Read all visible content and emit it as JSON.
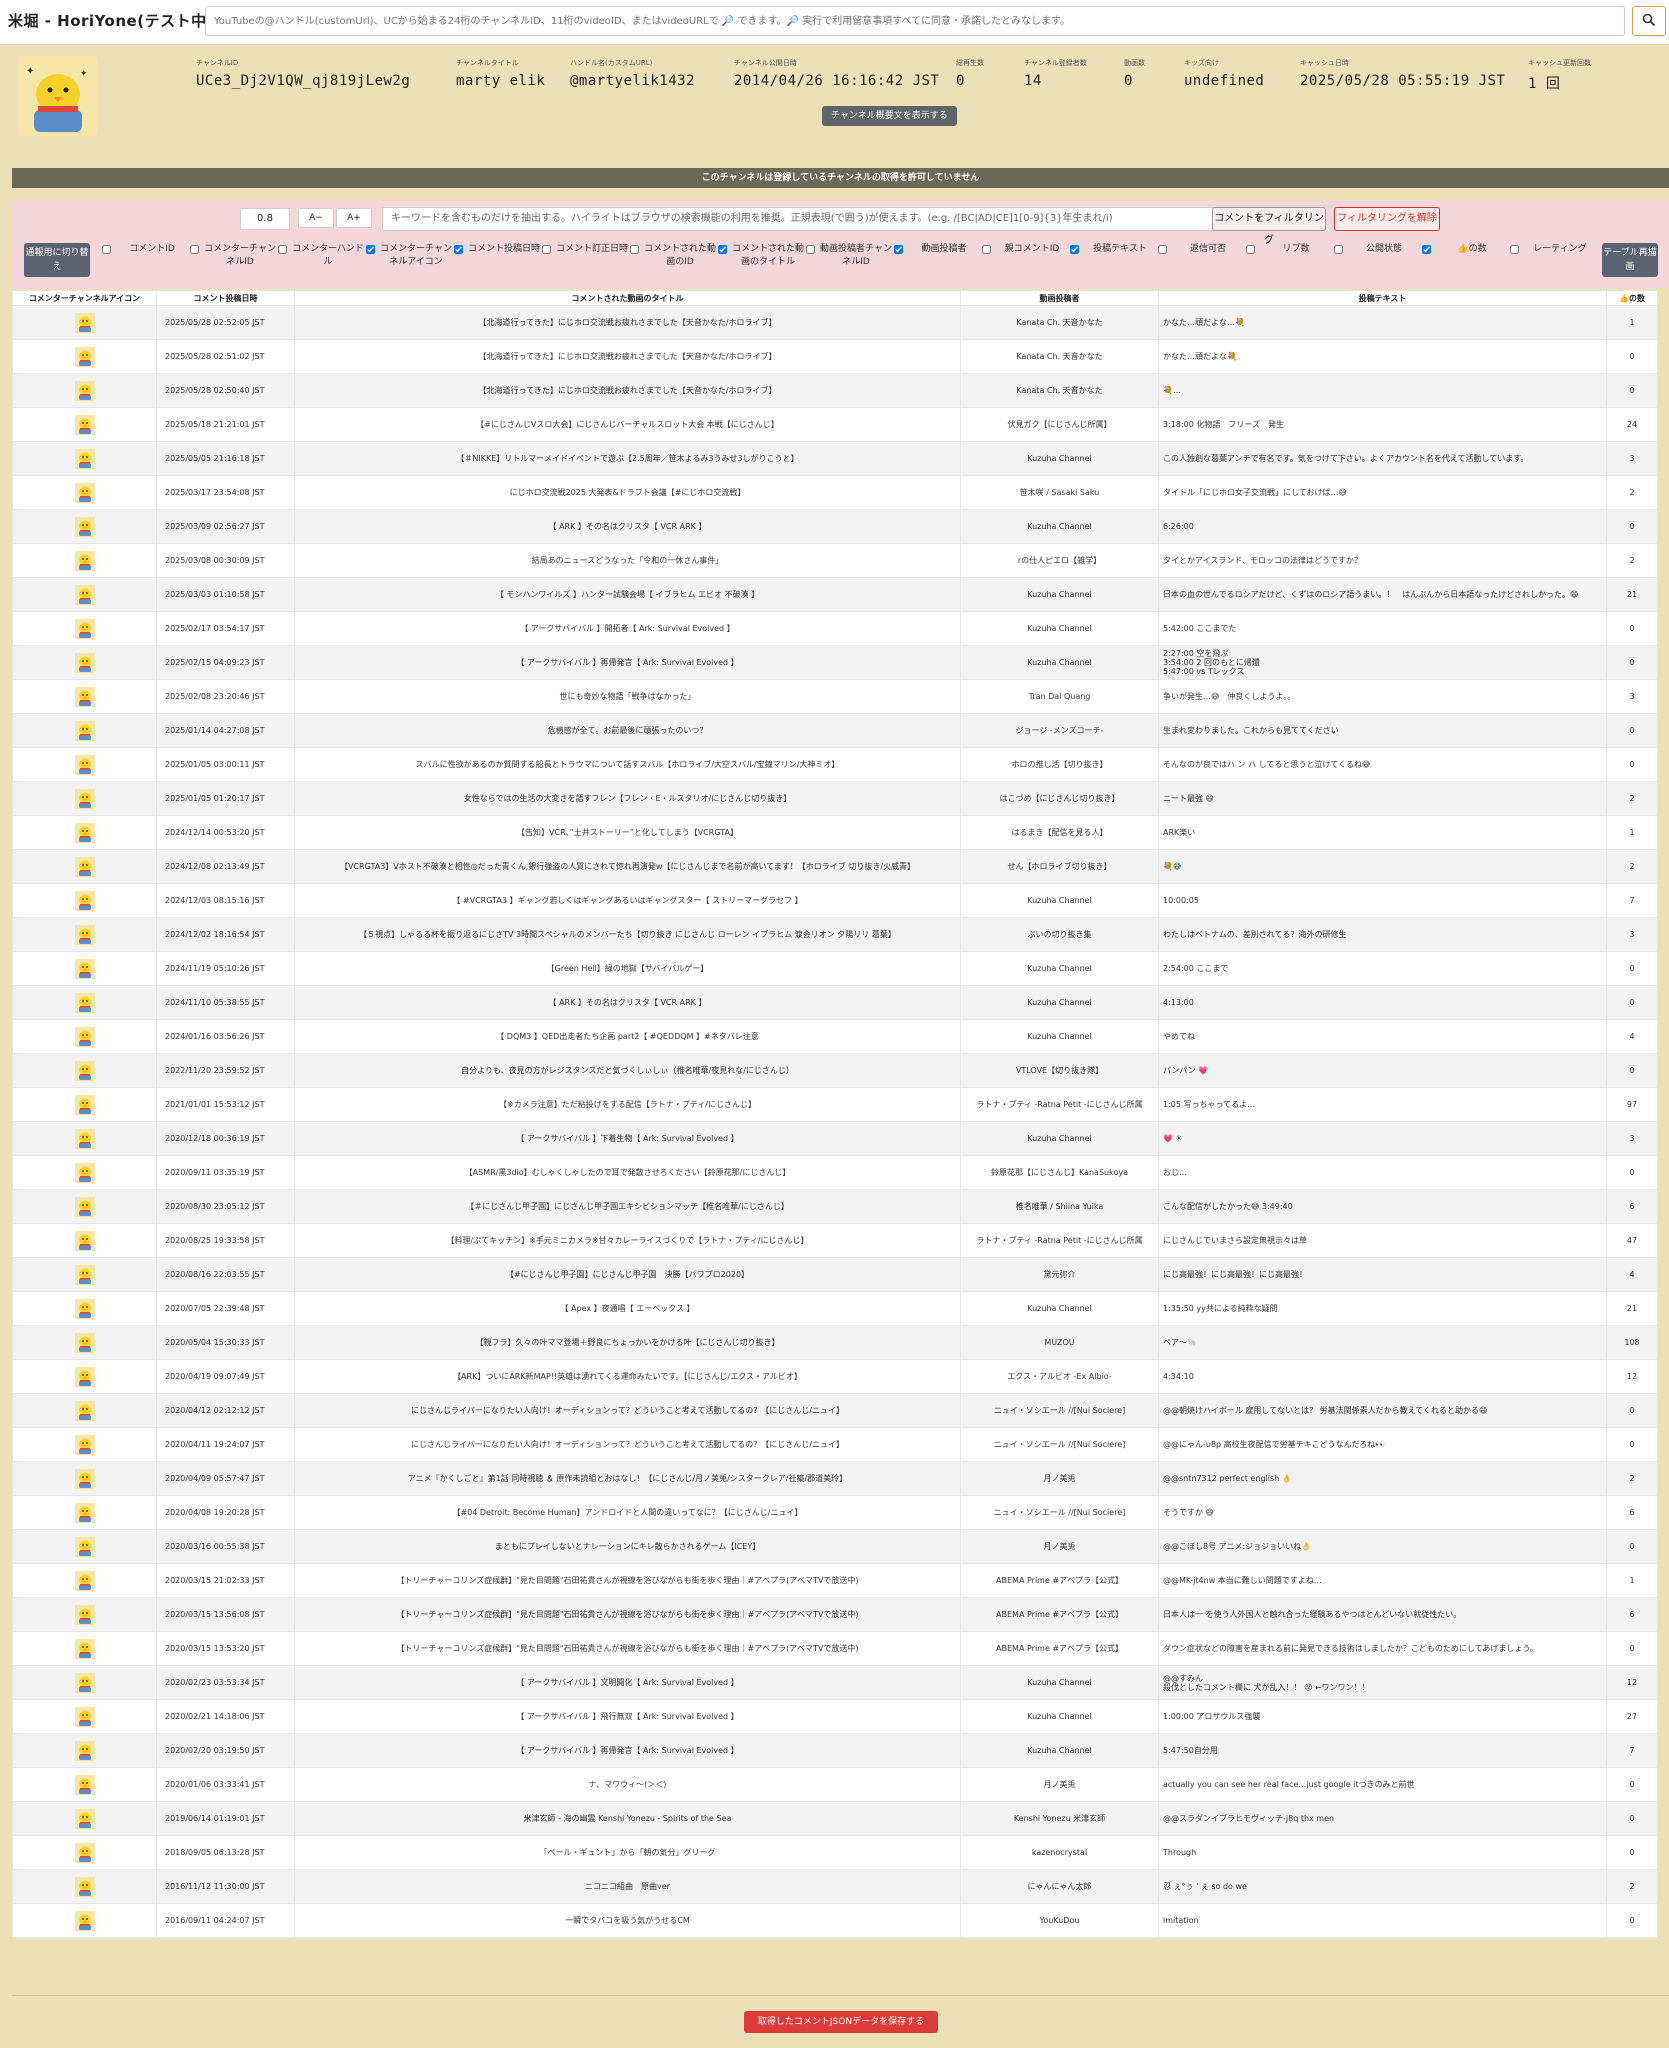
{
  "app": {
    "title": "米堀 - HoriYone(テスト中)"
  },
  "search": {
    "placeholder": "YouTubeの@ハンドル(customUrl)、UCから始まる24桁のチャンネルID、11桁のvideoID、またはvideoURLで 🔎 できます。🔎 実行で利用留意事項すべてに同意・承諾したとみなします。",
    "button_icon": "search-icon"
  },
  "channel": {
    "stats": [
      {
        "label": "チャンネルID",
        "value": "UCe3_Dj2V1QW_qj819jLew2g"
      },
      {
        "label": "チャンネルタイトル",
        "value": "marty elik"
      },
      {
        "label": "ハンドル名(カスタムURL)",
        "value": "@martyelik1432"
      },
      {
        "label": "チャンネル公開日時",
        "value": "2014/04/26 16:16:42 JST"
      },
      {
        "label": "総再生数",
        "value": "0"
      },
      {
        "label": "チャンネル登録者数",
        "value": "14"
      },
      {
        "label": "動画数",
        "value": "0"
      },
      {
        "label": "キッズ向け",
        "value": "undefined"
      },
      {
        "label": "キャッシュ日時",
        "value": "2025/05/28 05:55:19 JST"
      },
      {
        "label": "キャッシュ更新回数",
        "value": "1 回"
      }
    ],
    "desc_button": "チャンネル概要文を表示する",
    "notice": "このチャンネルは登録しているチャンネルの取得を許可していません"
  },
  "filter": {
    "font_scale": "0.8",
    "font_down": "A−",
    "font_up": "A+",
    "keyword_placeholder": "キーワードを含むものだけを抽出する。ハイライトはブラウザの検索機能の利用を推奨。正規表現(で囲う)が使えます。(e.g. /[BC|AD|CE]1[0-9]{3}年生まれ/i)",
    "filter_button": "コメントをフィルタリング",
    "clear_button": "フィルタリングを解除",
    "toggle_button": "通報用に切り替え",
    "redraw_button": "テーブル再描画",
    "columns": [
      {
        "label": "コメントID",
        "checked": false
      },
      {
        "label": "コメンターチャンネルID",
        "checked": false
      },
      {
        "label": "コメンターハンドル",
        "checked": false
      },
      {
        "label": "コメンターチャンネルアイコン",
        "checked": true
      },
      {
        "label": "コメント投稿日時",
        "checked": true
      },
      {
        "label": "コメント訂正日時",
        "checked": false
      },
      {
        "label": "コメントされた動画のID",
        "checked": false
      },
      {
        "label": "コメントされた動画のタイトル",
        "checked": true
      },
      {
        "label": "動画投稿者チャンネルID",
        "checked": false
      },
      {
        "label": "動画投稿者",
        "checked": true
      },
      {
        "label": "親コメントID",
        "checked": false
      },
      {
        "label": "投稿テキスト",
        "checked": true
      },
      {
        "label": "返信可否",
        "checked": false
      },
      {
        "label": "リプ数",
        "checked": false
      },
      {
        "label": "公開状態",
        "checked": false
      },
      {
        "label": "👍の数",
        "checked": true
      },
      {
        "label": "レーティング",
        "checked": false
      }
    ]
  },
  "table": {
    "headers": [
      "コメンターチャンネルアイコン",
      "コメント投稿日時",
      "コメントされた動画のタイトル",
      "動画投稿者",
      "投稿テキスト",
      "👍の数"
    ],
    "rows": [
      {
        "date": "2025/05/28 02:52:05 JST",
        "title": "【北海道行ってきた】にじホロ交流戦お疲れさまでした【天音かなた/ホロライブ】",
        "author": "Kanata Ch. 天音かなた",
        "text": "かなた…頑だよな…💐",
        "likes": "1"
      },
      {
        "date": "2025/05/28 02:51:02 JST",
        "title": "【北海道行ってきた】にじホロ交流戦お疲れさまでした【天音かなた/ホロライブ】",
        "author": "Kanata Ch. 天音かなた",
        "text": "かなた…頑だよな💐",
        "likes": "0"
      },
      {
        "date": "2025/05/28 02:50:40 JST",
        "title": "【北海道行ってきた】にじホロ交流戦お疲れさまでした【天音かなた/ホロライブ】",
        "author": "Kanata Ch. 天音かなた",
        "text": "💐…",
        "likes": "0"
      },
      {
        "date": "2025/05/18 21:21:01 JST",
        "title": "【#にじさんじVスロ大会】にじさんじバーチャルスロット大会 本戦【にじさんじ】",
        "author": "伏見ガク【にじさんじ所属】",
        "text": "3:18:00 化物語　フリーズ　発生",
        "likes": "24"
      },
      {
        "date": "2025/05/05 21:16:18 JST",
        "title": "【＃NIKKE】リトルマーメイドイベントで遊ぶ【2.5周年／笹木よるみ3うみせ3しがりこうと】",
        "author": "Kuzuha Channel",
        "text": "この人独創な葛葉アンチで有名です。気をつけて下さい。よくアカウント名を代えて活動しています。",
        "likes": "3"
      },
      {
        "date": "2025/03/17 23:54:08 JST",
        "title": "にじホロ交流戦2025 大発表&ドラフト会議【#にじホロ交流戦】",
        "author": "笹木咲 / Sasaki Saku",
        "text": "タイトル「にじホロ女子交流戦」にしておけば…😅",
        "likes": "2"
      },
      {
        "date": "2025/03/09 02:56:27 JST",
        "title": "【 ARK 】その名はクリスタ【 VCR ARK 】",
        "author": "Kuzuha Channel",
        "text": "6:26:00",
        "likes": "0"
      },
      {
        "date": "2025/03/08 00:30:09 JST",
        "title": "結局あのニュースどうなった「令和の一休さん事件」",
        "author": "rの仕人ピエロ【雑学】",
        "text": "タイとかアイスランド、モロッコの法律はどうですか？",
        "likes": "2"
      },
      {
        "date": "2025/03/03 01:10:58 JST",
        "title": "【 モンハンワイルズ 】ハンター試験会場【 イブラヒム エビオ 不破湊 】",
        "author": "Kuzuha Channel",
        "text": "日本の血の世んでるロシアだけど、くずはのロシア語うまい。！　はんぶんから日本語なったけどされしかった。😄",
        "likes": "21"
      },
      {
        "date": "2025/02/17 03:54:17 JST",
        "title": "【 アークサバイバル 】開拓者【 Ark: Survival Evolved 】",
        "author": "Kuzuha Channel",
        "text": "5:42:00 ここまでた",
        "likes": "0"
      },
      {
        "date": "2025/02/15 04:09:23 JST",
        "title": "【 アークサバイバル 】再帰発言【 Ark: Survival Evolved 】",
        "author": "Kuzuha Channel",
        "text": "2:27:00 空を飛ぶ\n3:54:00 2 回のもとに帰還\n5:47:00 vs Tレックス",
        "likes": "0"
      },
      {
        "date": "2025/02/08 23:20:46 JST",
        "title": "世にも奇妙な物語「戦争はなかった」",
        "author": "Tran Dai Quang",
        "text": "争いが発生…😅　仲良くしようよ。。",
        "likes": "3"
      },
      {
        "date": "2025/01/14 04:27:08 JST",
        "title": "危機感が全て。お前最後に頑張ったのいつ？",
        "author": "ジョージ -メンズコーチ-",
        "text": "生まれ変わりました。これからも見ててください",
        "likes": "0"
      },
      {
        "date": "2025/01/05 03:00:11 JST",
        "title": "スバルに性欲があるのか質問する船長とトラウマについて話すスバル【ホロライブ/大空スバル/宝鐘マリン/大神ミオ】",
        "author": "ホロの推し活【切り抜き】",
        "text": "そんなのが良ではハ ン ハ してると思うと泣けてくるね😅",
        "likes": "0"
      },
      {
        "date": "2025/01/05 01:20:17 JST",
        "title": "女性ならではの生活の大変さを語すフレン【フレン・E・ルスタリオ/にじさんじ切り抜き】",
        "author": "はこづめ【にじさんじ切り抜き】",
        "text": "ニート最強 😄",
        "likes": "2"
      },
      {
        "date": "2024/12/14 00:53:20 JST",
        "title": "【告知】VCR、”土井ストーリー”と化してしまう【VCRGTA】",
        "author": "はるまき【配信を見る人】",
        "text": "ARK楽い",
        "likes": "1"
      },
      {
        "date": "2024/12/08 02:13:49 JST",
        "title": "【VCRGTA3】Vホスト不破湊と相性◎だった青くん,銀行強盗の人質にされて惚れ再演発w【にじさんじまで名前が高いてます！【ホロライブ 切り抜き/火威青】",
        "author": "せん【ホロライブ切り抜き】",
        "text": "💐😅",
        "likes": "2"
      },
      {
        "date": "2024/12/03 08:15:16 JST",
        "title": "【 #VCRGTA3 】ギャング若しくはギャングあるいはギャングスター【 ストリーマーグラセフ 】",
        "author": "Kuzuha Channel",
        "text": "10:00:05",
        "likes": "7"
      },
      {
        "date": "2024/12/02 18:16:54 JST",
        "title": "【５視点】しゃるる杯を振り返るにじさTV 3時間スペシャルのメンバーたち【切り抜き にじさんじ ローレン イブラヒム 渡会リオン 夕陽リリ 葛葉】",
        "author": "ぶいの切り抜き集",
        "text": "わたしはベトナムの、差別されてる？海外の研修生",
        "likes": "3"
      },
      {
        "date": "2024/11/19 05:10:26 JST",
        "title": "【Green Hell】緑の地獄【サバイバルゲー】",
        "author": "Kuzuha Channel",
        "text": "2:54:00 ここまで",
        "likes": "0"
      },
      {
        "date": "2024/11/10 05:38:55 JST",
        "title": "【 ARK 】その名はクリスタ【 VCR ARK 】",
        "author": "Kuzuha Channel",
        "text": "4:13:00",
        "likes": "0"
      },
      {
        "date": "2024/01/16 03:56:26 JST",
        "title": "【 DQM3 】QED出走者たち企画 part2【 #QEDDQM 】#ネタバレ注意",
        "author": "Kuzuha Channel",
        "text": "やめてね",
        "likes": "4"
      },
      {
        "date": "2022/11/20 23:59:52 JST",
        "title": "自分よりも、夜見の方がレジスタンスだと気づくしぃしぃ（椎名唯華/夜見れな/にじさんじ）",
        "author": "VTLOVE【切り抜き隊】",
        "text": "パンパン 💗",
        "likes": "0"
      },
      {
        "date": "2021/01/01 15:53:12 JST",
        "title": "【※カメラ注意】ただ粘投げをする配信【ラトナ・プティ/にじさんじ】",
        "author": "ラトナ・プティ -Ratna Petit -にじさんじ所属",
        "text": "1:05 写っちゃってるよ…",
        "likes": "97"
      },
      {
        "date": "2020/12/18 00:36:19 JST",
        "title": "【 アークサバイバル 】下着生物【 Ark: Survival Evolved 】",
        "author": "Kuzuha Channel",
        "text": "💗 ✳",
        "likes": "3"
      },
      {
        "date": "2020/09/11 03:35:19 JST",
        "title": "【ASMR/黒3dio】むしゃくしゃしたので耳で発散させろください【鈴原花那/にじさんじ】",
        "author": "鈴原花那【にじさんじ】KanaSukoya",
        "text": "おじ…",
        "likes": "0"
      },
      {
        "date": "2020/08/30 23:05:12 JST",
        "title": "【＃にじさんじ甲子園】にじさんじ甲子園エキシビションマッチ【椎名唯華/にじさんじ】",
        "author": "椎名唯華 / Shiina Yuika",
        "text": "こんな配信がしたかった😅 3:49:40",
        "likes": "6"
      },
      {
        "date": "2020/08/25 19:33:58 JST",
        "title": "【料理/ぷてキッチン】※手元ミニカメラ※甘々カレーライスづくりで【ラトナ・プティ/にじさんじ】",
        "author": "ラトナ・プティ -Ratna Petit -にじさんじ所属",
        "text": "にじさんじでいまさら設定無視示々は草",
        "likes": "47"
      },
      {
        "date": "2020/08/16 22:03:55 JST",
        "title": "【#にじさんじ甲子園】にじさんじ甲子園　決勝【パワプロ2020】",
        "author": "黛元弥介",
        "text": "にじ高最強！にじ高最強！にじ高最強！",
        "likes": "4"
      },
      {
        "date": "2020/07/05 22:39:48 JST",
        "title": "【 Apex 】夜通唱【 エーペックス 】",
        "author": "Kuzuha Channel",
        "text": "1:35:50 yy共による純粋な疑問",
        "likes": "21"
      },
      {
        "date": "2020/05/04 15:30:33 JST",
        "title": "【親フラ】久々の叶ママ登場＋野良にちょっかいをかける叶【にじさんじ切り抜き】",
        "author": "MUZOU",
        "text": "ペア～🐚",
        "likes": "108"
      },
      {
        "date": "2020/04/19 09:07:49 JST",
        "title": "【ARK】ついにARK新MAP!!英雄は湧れてくる運命みたいです。【にじさんじ/エクス・アルビオ】",
        "author": "エクス・アルビオ -Ex Albio-",
        "text": "4:34:10",
        "likes": "12"
      },
      {
        "date": "2020/04/12 02:12:12 JST",
        "title": "にじさんじライバーになりたい人向け！オーディションって？どういうこと考えて活動してるの？【にじさんじ/ニュイ】",
        "author": "ニュイ・ソシエール //[Nui Sociere]",
        "text": "@@朝焼けハイボール 雇用してないとは？ 労基法関係素人だから教えてくれると助かる😄",
        "likes": "0"
      },
      {
        "date": "2020/04/11 19:24:07 JST",
        "title": "にじさんじライバーになりたい人向け！オーディションって？どういうこと考えて活動してるの？【にじさんじ/ニュイ】",
        "author": "ニュイ・ソシエール //[Nui Sociere]",
        "text": "@@にゃん-u8p 高校生夜配信で労基チキこどうなんだろね👀",
        "likes": "0"
      },
      {
        "date": "2020/04/09 05:57:47 JST",
        "title": "アニメ『かくしごと』第1話 同時視聴 ＆ 原作未読組とおはなし！【にじさんじ/月ノ美兎/シスタークレア/社築/郡道美玲】",
        "author": "月ノ美兎",
        "text": "@@sntn7312 perfect english 👌",
        "likes": "2"
      },
      {
        "date": "2020/04/08 19:20:28 JST",
        "title": "【#04 Detroit: Become Human】アンドロイドと人間の違いってなに？【にじさんじ/ニュイ】",
        "author": "ニュイ・ソシエール //[Nui Sociere]",
        "text": "そうですか 😄",
        "likes": "6"
      },
      {
        "date": "2020/03/16 00:55:38 JST",
        "title": "まともにプレイしないとナレーションにキレ散らかされるゲーム【ICEY】",
        "author": "月ノ美兎",
        "text": "@@こぼし8号 アニメ:ジョジョいいね👌",
        "likes": "0"
      },
      {
        "date": "2020/03/15 21:02:33 JST",
        "title": "【トリーチャーコリンズ症候群】\"見た目問題\"石田祐貴さんが視線を浴びながらも街を歩く理由｜#アベプラ(アベマTVで放送中)",
        "author": "ABEMA Prime #アベプラ【公式】",
        "text": "@@MK-jt4nw 本当に難しい問題ですよね…",
        "likes": "1"
      },
      {
        "date": "2020/03/15 13:56:08 JST",
        "title": "【トリーチャーコリンズ症候群】\"見た目問題\"石田祐貴さんが視線を浴びながらも街を歩く理由｜#アベプラ(アベマTVで放送中)",
        "author": "ABEMA Prime #アベプラ【公式】",
        "text": "日本人は一 を使う人外国人と触れ合った経験あるやつはとんどいない就従性たい。",
        "likes": "6"
      },
      {
        "date": "2020/03/15 13:53:20 JST",
        "title": "【トリーチャーコリンズ症候群】\"見た目問題\"石田祐貴さんが視線を浴びながらも街を歩く理由｜#アベプラ(アベマTVで放送中)",
        "author": "ABEMA Prime #アベプラ【公式】",
        "text": "ダウン症状などの障害を産まれる前に発見できる技術はしましたか？こどものためにしてあげましょう。",
        "likes": "0"
      },
      {
        "date": "2020/02/23 03:53:34 JST",
        "title": "【 アークサバイバル 】文明開化【 Ark: Survival Evolved 】",
        "author": "Kuzuha Channel",
        "text": "@@すみん\n殺伐としたコメント欄に 犬が乱入！！ 😡 ←ワンワン！！",
        "likes": "12"
      },
      {
        "date": "2020/02/21 14:18:06 JST",
        "title": "【 アークサバイバル 】飛行無双【 Ark: Survival Evolved 】",
        "author": "Kuzuha Channel",
        "text": "1:00:00 アロサウルス強襲",
        "likes": "27"
      },
      {
        "date": "2020/02/20 03:19:50 JST",
        "title": "【 アークサバイバル 】再帰発言【 Ark: Survival Evolved 】",
        "author": "Kuzuha Channel",
        "text": "5:47:50自分用",
        "likes": "7"
      },
      {
        "date": "2020/01/06 03:33:41 JST",
        "title": "ナ、マワウィ～(＞＜)",
        "author": "月ノ美兎",
        "text": "actually you can see her real face…just google itつきのみと前世",
        "likes": "0"
      },
      {
        "date": "2019/06/14 01:19:01 JST",
        "title": "米津玄師 - 海の幽霊 Kenshi Yonezu - Spirits of the Sea",
        "author": "Kenshi Yonezu 米津玄師",
        "text": "@@スラダンイブラヒモヴィッチ-j8q thx men",
        "likes": "0"
      },
      {
        "date": "2018/09/05 06:13:28 JST",
        "title": "「ペール・ギュント」から「朝の気分」グリーグ",
        "author": "kazenocrystal",
        "text": "Through",
        "likes": "0"
      },
      {
        "date": "2016/11/12 11:30:00 JST",
        "title": "ニコニコ組曲　原曲ver",
        "author": "にゃんにゃん太郎",
        "text": "忍 ぇ°ぅ ' ぇ so do we",
        "likes": "2"
      },
      {
        "date": "2016/09/11 04:24:07 JST",
        "title": "一瞬でタバコを吸う気がうせるCM",
        "author": "YouKuDou",
        "text": "imitation",
        "likes": "0"
      }
    ]
  },
  "footer": {
    "save_button": "取得したコメントJSONデータを保存する"
  },
  "colors": {
    "page_bg": "#ece0b8",
    "filter_bg": "#f3d7da",
    "accent_red": "#dd3a3a",
    "notice_bg": "#6a6a58"
  }
}
